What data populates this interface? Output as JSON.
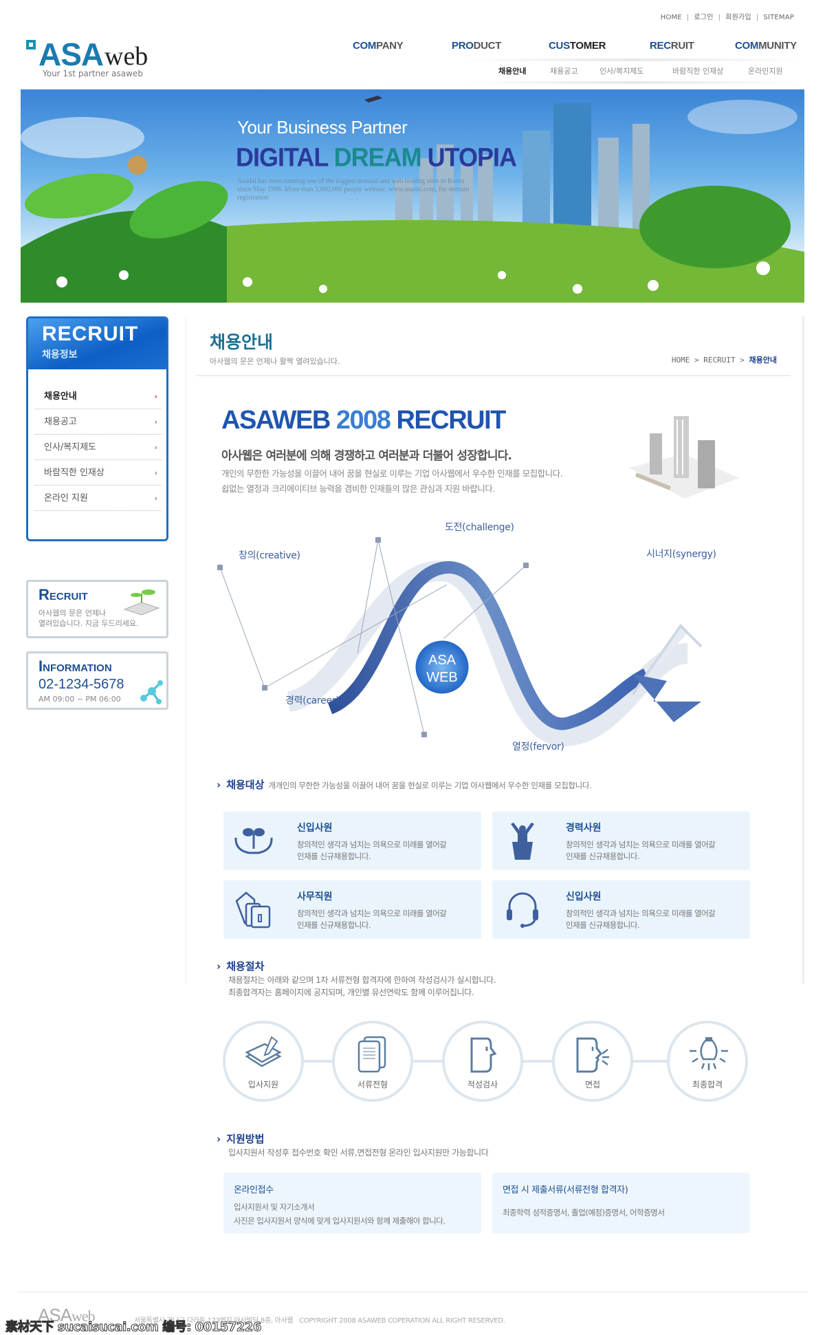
{
  "top_links": [
    "HOME",
    "로그인",
    "회원가입",
    "SITEMAP"
  ],
  "logo": {
    "name_bold": "ASA",
    "name_light": "web",
    "tagline": "Your 1st partner asaweb"
  },
  "nav": [
    {
      "bold": "COM",
      "rest": "PANY"
    },
    {
      "bold": "PRO",
      "rest": "DUCT"
    },
    {
      "bold": "CUS",
      "rest": "TOMER"
    },
    {
      "bold": "REC",
      "rest": "RUIT"
    },
    {
      "bold": "COM",
      "rest": "MUNITY"
    }
  ],
  "subnav": [
    "채용안내",
    "채용공고",
    "인사/복지제도",
    "바람직한 인재상",
    "온라인지원"
  ],
  "banner": {
    "line1": "Your Business Partner",
    "line2a": "DIGITAL ",
    "line2b": "DREAM",
    "line2c": " UTOPIA",
    "body": "Asadal has been running one of the biggest domain and web hosting sites in Korea since May 1998. More than 3,000,000 people website, www.asadal.com, for domain registration"
  },
  "sidebar": {
    "title": "RECRUIT",
    "subtitle": "채용정보",
    "items": [
      "채용안내",
      "채용공고",
      "인사/복지제도",
      "바람직한 인재상",
      "온라인 지원"
    ],
    "chevron": "›"
  },
  "promo_recruit": {
    "title": "Recruit",
    "text1": "아사웹의 문은 언제나",
    "text2": "열려있습니다. 지금 두드리세요."
  },
  "promo_info": {
    "title": "Information",
    "phone": "02-1234-5678",
    "hours": "AM 09:00 ~ PM 06:00"
  },
  "page": {
    "title": "채용안내",
    "subtitle": "아사웹의 문은 언제나 활짝 열려있습니다.",
    "breadcrumb": [
      "HOME",
      ">",
      "RECRUIT",
      ">",
      "채용안내"
    ]
  },
  "intro": {
    "headline_a": "ASAWEB ",
    "headline_b": "2008",
    "headline_c": " RECRUIT",
    "lead": "아사웹은 여러분에 의해 경쟁하고 여러분과 더불어 성장합니다.",
    "line1": "개인의 무한한 가능성을 이끌어 내어 꿈을 현실로 이루는 기업 아사웹에서 우수한 인재를 모집합니다.",
    "line2": "쉽없는 열정과 크리에이티브 능력을 겸비한 인재들의 많은 관심과 지원 바랍니다."
  },
  "diagram": {
    "center_1": "ASA",
    "center_2": "WEB",
    "labels": {
      "creative": "창의(creative)",
      "challenge": "도전(challenge)",
      "synergy": "시너지(synergy)",
      "career": "경력(career)",
      "fervor": "열정(fervor)"
    }
  },
  "targets": {
    "heading": "채용대상",
    "desc": "개개인의 무한한 가능성을 이끌어 내어 꿈을 현실로 이루는 기업 아사웹에서 우수한 인재를 모집합니다.",
    "cards": [
      {
        "icon": "sprout-hands-icon",
        "title": "신입사원",
        "l1": "창의적인 생각과 넘치는 의욕으로 미래를 열어갈",
        "l2": "인재를 신규채용합니다."
      },
      {
        "icon": "person-podium-icon",
        "title": "경력사원",
        "l1": "창의적인 생각과 넘치는 의욕으로 미래를 열어갈",
        "l2": "인재를 신규채용합니다."
      },
      {
        "icon": "folders-icon",
        "title": "사무직원",
        "l1": "창의적인 생각과 넘치는 의욕으로 미래를 열어갈",
        "l2": "인재를 신규채용합니다."
      },
      {
        "icon": "headset-icon",
        "title": "신입사원",
        "l1": "창의적인 생각과 넘치는 의욕으로 미래를 열어갈",
        "l2": "인재를 신규채용합니다."
      }
    ]
  },
  "process": {
    "heading": "채용절차",
    "l1": "채용절차는 아래와 같으며 1차 서류전형 합격자에 한하여 작성검사가 실시합니다.",
    "l2": "최종합격자는 홈페이지에 공지되며, 개인별 유선연락도 함께 이루어집니다.",
    "steps": [
      "입사지원",
      "서류전형",
      "적성검사",
      "면접",
      "최종합격"
    ]
  },
  "apply": {
    "heading": "지원방법",
    "desc": "입사지원서 작성후  접수번호 확인  서류,면접전형 온라인 입사지원만 가능합니다",
    "cards": [
      {
        "title": "온라인접수",
        "l1": "입사지원서 및 자기소개서",
        "l2": "사진은 입사지원서 양식에 맞게 입사지원서와 함께 제출해야 합니다."
      },
      {
        "title": "면접 시 제출서류(서류전형 합격자)",
        "l1": "",
        "l2": "최종학력 성적증명서, 졸업(예정)증명서, 어학증명서"
      }
    ]
  },
  "footer": {
    "logo_a": "ASA",
    "logo_b": "web",
    "address": "서울특별시 가나구 다라동 123번지 아사빌딩 8층, 아사웹",
    "copyright": "COPYRIGHT 2008 ASAWEB COPERATION ALL RIGHT RESERVED."
  },
  "watermark": "素材天下 sucaisucai.com  编号: 00157226",
  "colors": {
    "brand_blue": "#1f6fc5",
    "navy": "#1c4f93",
    "card_bg": "#eaf4fc"
  }
}
